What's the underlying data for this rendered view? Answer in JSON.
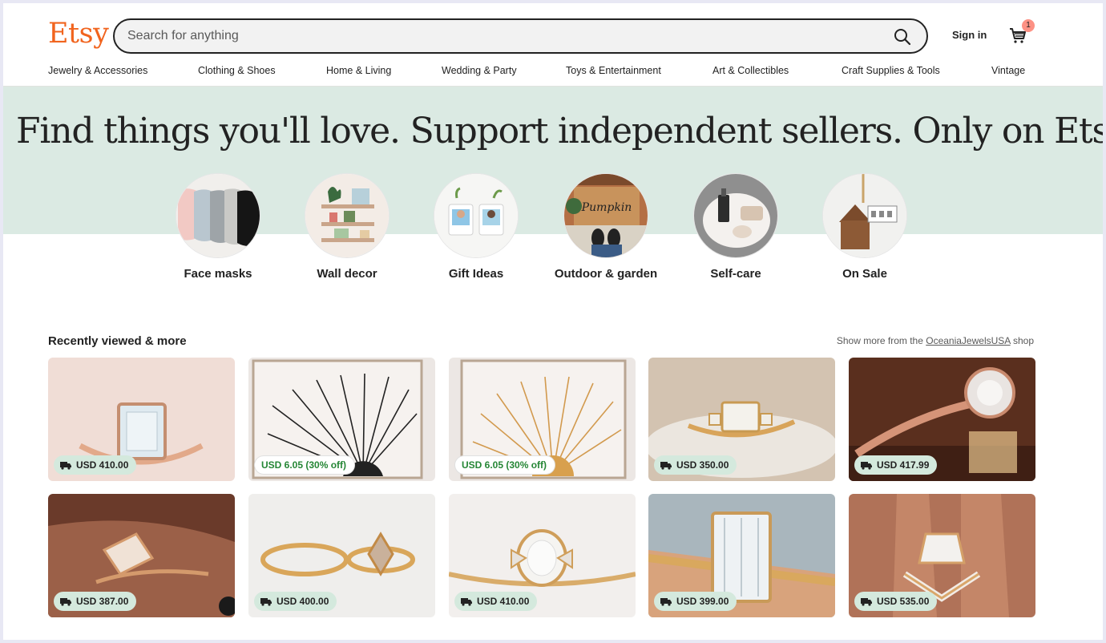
{
  "header": {
    "logo": "Etsy",
    "search_placeholder": "Search for anything",
    "signin_label": "Sign in",
    "cart_count": "1"
  },
  "category_nav": [
    "Jewelry & Accessories",
    "Clothing & Shoes",
    "Home & Living",
    "Wedding & Party",
    "Toys & Entertainment",
    "Art & Collectibles",
    "Craft Supplies & Tools",
    "Vintage"
  ],
  "hero": {
    "title": "Find things you'll love. Support independent sellers. Only on Etsy.",
    "categories": [
      {
        "label": "Face masks",
        "icon": "face-masks-image"
      },
      {
        "label": "Wall decor",
        "icon": "wall-decor-image"
      },
      {
        "label": "Gift Ideas",
        "icon": "gift-ideas-image"
      },
      {
        "label": "Outdoor & garden",
        "icon": "outdoor-garden-image"
      },
      {
        "label": "Self-care",
        "icon": "self-care-image"
      },
      {
        "label": "On Sale",
        "icon": "on-sale-image"
      }
    ]
  },
  "recently_viewed": {
    "title": "Recently viewed & more",
    "more_prefix": "Show more from the",
    "shop_name": "OceaniaJewelsUSA",
    "more_suffix": "shop",
    "items": [
      {
        "price": "USD 410.00",
        "sale": false,
        "image": "emerald-cut-ring"
      },
      {
        "price": "USD 6.05 (30% off)",
        "sale": true,
        "image": "sun-line-art-black"
      },
      {
        "price": "USD 6.05 (30% off)",
        "sale": true,
        "image": "sun-line-art-gold"
      },
      {
        "price": "USD 350.00",
        "sale": false,
        "image": "emerald-baguette-ring"
      },
      {
        "price": "USD 417.99",
        "sale": false,
        "image": "halo-ring"
      },
      {
        "price": "USD 387.00",
        "sale": false,
        "image": "kite-ring-on-hand"
      },
      {
        "price": "USD 400.00",
        "sale": false,
        "image": "ring-set"
      },
      {
        "price": "USD 410.00",
        "sale": false,
        "image": "oval-vintage-ring"
      },
      {
        "price": "USD 399.00",
        "sale": false,
        "image": "emerald-cut-closeup"
      },
      {
        "price": "USD 535.00",
        "sale": false,
        "image": "chevron-ring-on-hand"
      }
    ]
  },
  "colors": {
    "brand": "#f1641e",
    "hero_bg": "#dbeae3",
    "badge_bg": "#d4e9dd",
    "sale_text": "#258635"
  }
}
